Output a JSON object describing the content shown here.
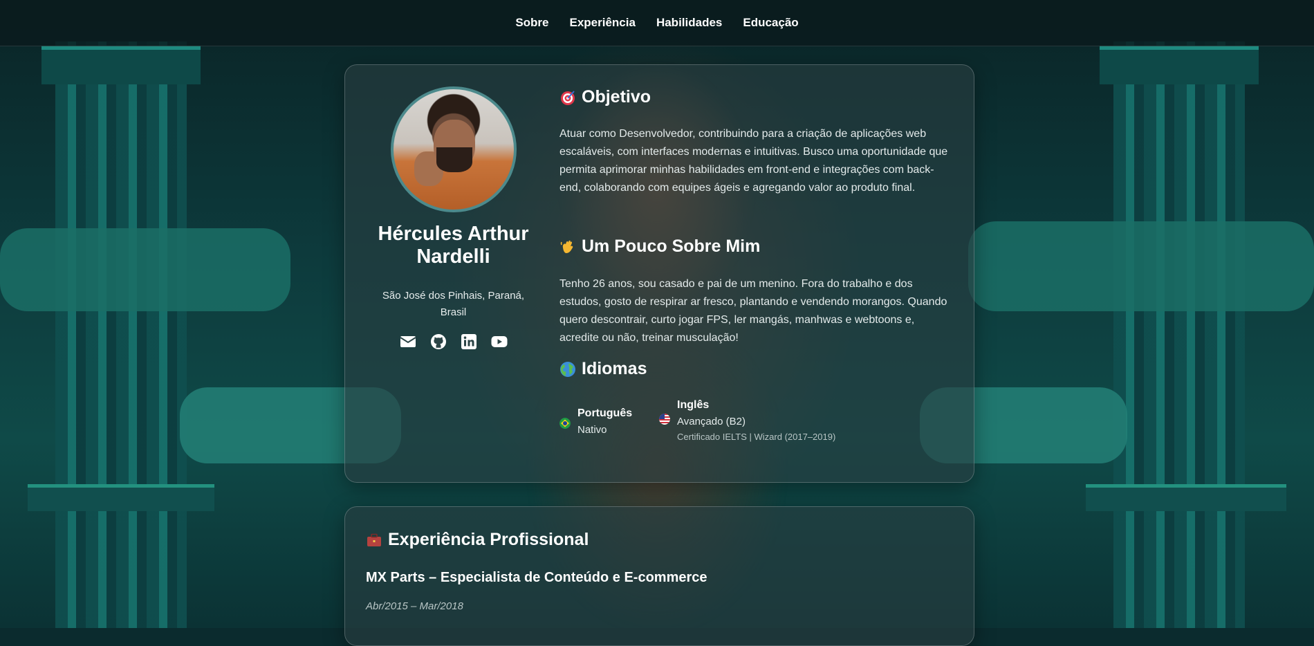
{
  "nav": {
    "items": [
      {
        "label": "Sobre"
      },
      {
        "label": "Experiência"
      },
      {
        "label": "Habilidades"
      },
      {
        "label": "Educação"
      }
    ]
  },
  "profile": {
    "name": "Hércules Arthur Nardelli",
    "location": "São José dos Pinhais, Paraná, Brasil",
    "socials": [
      "envelope-icon",
      "github-icon",
      "linkedin-icon",
      "youtube-icon"
    ]
  },
  "objective": {
    "title": "Objetivo",
    "icon": "target-icon",
    "text": "Atuar como Desenvolvedor, contribuindo para a criação de aplicações web escaláveis, com interfaces modernas e intuitivas. Busco uma oportunidade que permita aprimorar minhas habilidades em front-end e integrações com back-end, colaborando com equipes ágeis e agregando valor ao produto final."
  },
  "about": {
    "title": "Um Pouco Sobre Mim",
    "icon": "waving-hand-icon",
    "text": "Tenho 26 anos, sou casado e pai de um menino. Fora do trabalho e dos estudos, gosto de respirar ar fresco, plantando e vendendo morangos. Quando quero descontrair, curto jogar FPS, ler mangás, manhwas e webtoons e, acredite ou não, treinar musculação!"
  },
  "languages": {
    "title": "Idiomas",
    "icon": "globe-icon",
    "items": [
      {
        "name": "Português",
        "level": "Nativo",
        "note": "",
        "flag": "brazil-flag-icon"
      },
      {
        "name": "Inglês",
        "level": "Avançado (B2)",
        "note": "Certificado IELTS | Wizard (2017–2019)",
        "flag": "usa-flag-icon"
      }
    ]
  },
  "experience": {
    "title": "Experiência Profissional",
    "icon": "briefcase-icon",
    "jobs": [
      {
        "title": "MX Parts – Especialista de Conteúdo e E-commerce",
        "dates": "Abr/2015 – Mar/2018"
      }
    ]
  },
  "colors": {
    "accent": "#1e8a80",
    "card_bg": "#283e40",
    "text": "#ffffff"
  }
}
